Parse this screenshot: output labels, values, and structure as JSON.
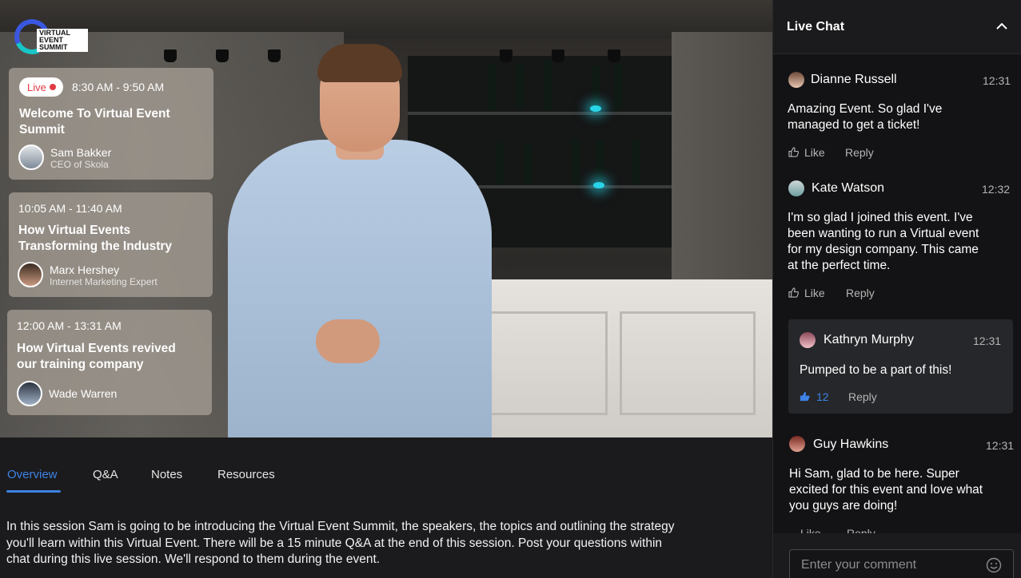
{
  "logo": {
    "text_lines": [
      "VIRTUAL",
      "EVENT",
      "SUMMIT"
    ]
  },
  "sessions": [
    {
      "live_label": "Live",
      "time": "8:30 AM - 9:50 AM",
      "title_lines": [
        "Welcome To Virtual Event",
        "Summit"
      ],
      "speaker": "Sam Bakker",
      "role": "CEO of Skola"
    },
    {
      "time": "10:05 AM - 11:40 AM",
      "title_lines": [
        "How Virtual Events",
        "Transforming the Industry"
      ],
      "speaker": "Marx Hershey",
      "role": "Internet Marketing Expert"
    },
    {
      "time": "12:00 AM - 13:31 AM",
      "title_lines": [
        "How Virtual Events revived",
        "our training company"
      ],
      "speaker": "Wade Warren"
    }
  ],
  "tabs": [
    "Overview",
    "Q&A",
    "Notes",
    "Resources"
  ],
  "description_lines": [
    "In this session Sam is going to be introducing the Virtual Event Summit, the speakers, the topics and outlining the strategy",
    "you'll learn within this Virtual Event. There will be a 15 minute Q&A at the end of this session. Post your questions within",
    "chat during this live session. We'll respond to them during the event."
  ],
  "chat": {
    "title": "Live Chat",
    "like_label": "Like",
    "reply_label": "Reply",
    "messages": [
      {
        "name": "Dianne Russell",
        "time": "12:31",
        "lines": [
          "Amazing Event. So glad I've",
          "managed to get a ticket!"
        ]
      },
      {
        "name": "Kate Watson",
        "time": "12:32",
        "lines": [
          "I'm so glad I joined this event. I've",
          "been wanting to run a Virtual event",
          "for my design company. This came",
          "at the perfect time."
        ]
      },
      {
        "name": "Kathryn Murphy",
        "time": "12:31",
        "lines": [
          "Pumped to be a part of this!"
        ],
        "likes": "12"
      },
      {
        "name": "Guy Hawkins",
        "time": "12:31",
        "lines": [
          "Hi Sam, glad to be here. Super",
          "excited for this event and love what",
          "you guys are doing!"
        ]
      }
    ],
    "comment_placeholder": "Enter your comment"
  },
  "colors": {
    "accent": "#3e82e6",
    "live": "#e23b44",
    "chat_bg": "#131315"
  },
  "icons": [
    "chevron-up-icon",
    "like-icon",
    "smiley-icon"
  ]
}
